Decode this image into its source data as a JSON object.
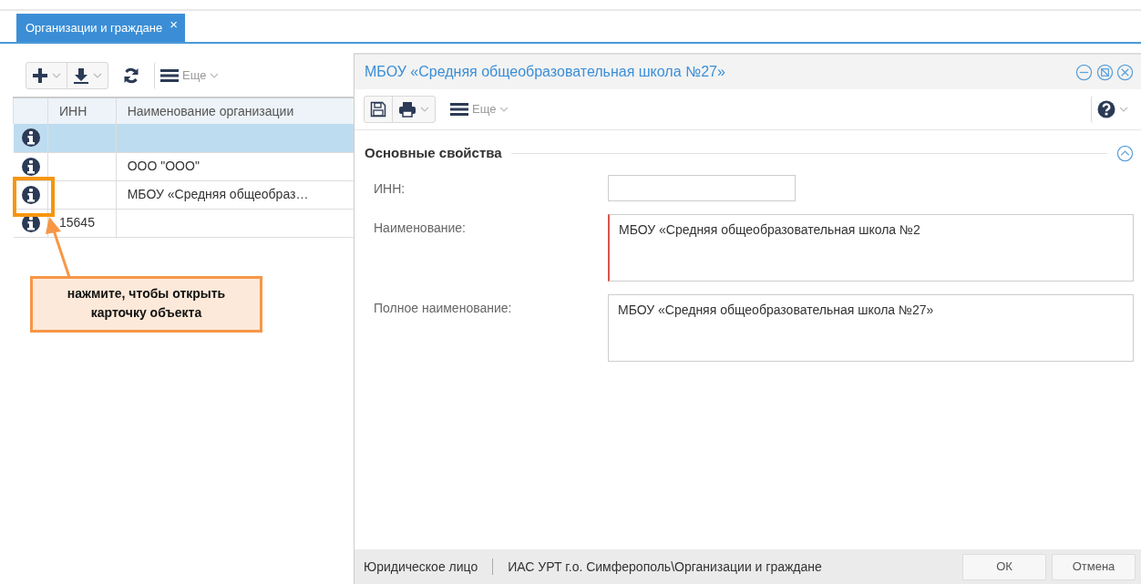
{
  "tab": {
    "label": "Организации и граждане",
    "selected": true,
    "close": "×"
  },
  "grid_toolbar": {
    "more": "Еще"
  },
  "grid": {
    "columns": [
      "ИНН",
      "Наименование организации"
    ],
    "rows": [
      {
        "selected": true
      },
      {
        "selected": false,
        "name": "ООО \"ООО\""
      },
      {
        "selected": false,
        "name": "МБОУ «Средняя общеобраз…",
        "highlighted": true
      },
      {
        "selected": false,
        "inn": "15645"
      }
    ]
  },
  "callout": {
    "text": "нажмите, чтобы открыть карточку объекта"
  },
  "dialog": {
    "title": "МБОУ «Средняя общеобразовательная школа №27»",
    "toolbar": {
      "more": "Еще"
    },
    "section": {
      "title": "Основные свойства",
      "expanded": true
    },
    "fields": [
      {
        "kind": "input",
        "label": "ИНН:"
      },
      {
        "kind": "textarea",
        "label": "Наименование:",
        "value": "МБОУ «Средняя общеобразовательная школа №2",
        "required": true
      },
      {
        "kind": "textarea",
        "label": "Полное наименование:",
        "value": "МБОУ «Средняя общеобразовательная школа №27»",
        "required": false
      }
    ],
    "status": {
      "type": "Юридическое лицо",
      "path": "ИАС УРТ г.о. Симферополь\\Организации и граждане"
    },
    "buttons": [
      "ОК",
      "Отмена"
    ]
  }
}
